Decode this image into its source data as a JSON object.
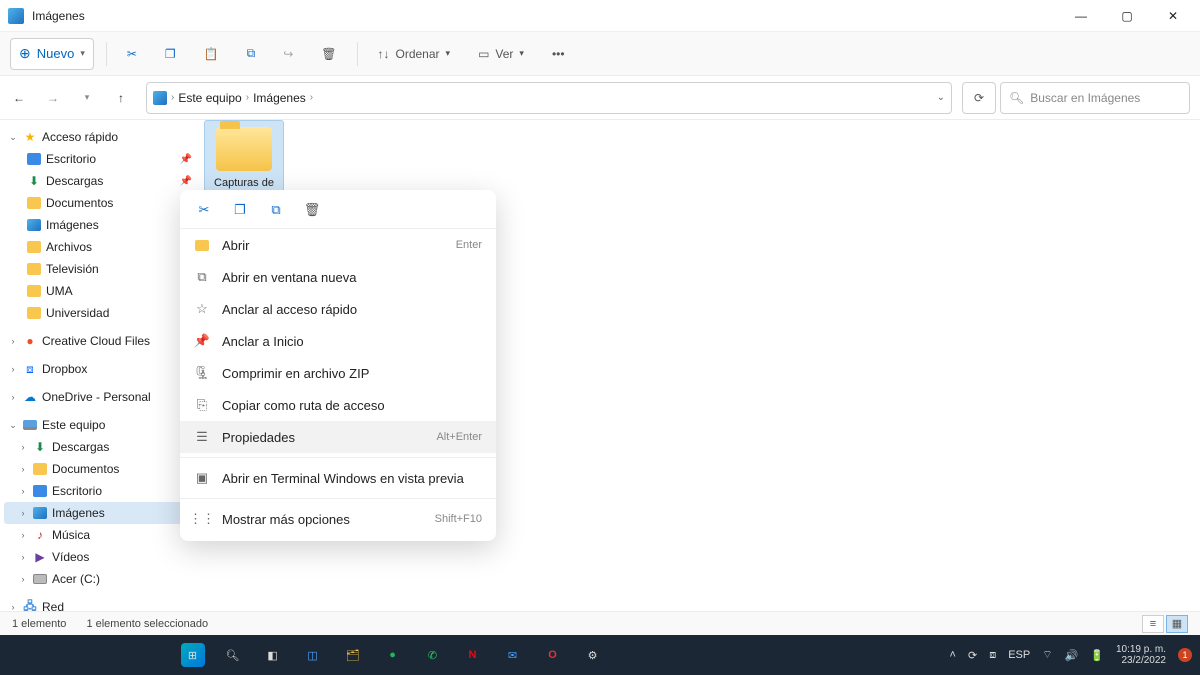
{
  "window": {
    "title": "Imágenes"
  },
  "toolbar": {
    "new_label": "Nuevo",
    "sort_label": "Ordenar",
    "view_label": "Ver"
  },
  "breadcrumb": {
    "root": "Este equipo",
    "current": "Imágenes"
  },
  "search": {
    "placeholder": "Buscar en Imágenes"
  },
  "sidebar": {
    "quick_access": "Acceso rápido",
    "quick_items": [
      {
        "label": "Escritorio",
        "pin": true,
        "ic": "blue"
      },
      {
        "label": "Descargas",
        "pin": true,
        "ic": "dl"
      },
      {
        "label": "Documentos",
        "pin": true,
        "ic": "folder"
      },
      {
        "label": "Imágenes",
        "pin": true,
        "ic": "img"
      },
      {
        "label": "Archivos",
        "pin": false,
        "ic": "folder"
      },
      {
        "label": "Televisión",
        "pin": false,
        "ic": "folder"
      },
      {
        "label": "UMA",
        "pin": false,
        "ic": "folder"
      },
      {
        "label": "Universidad",
        "pin": false,
        "ic": "folder"
      }
    ],
    "creative_cloud": "Creative Cloud Files",
    "dropbox": "Dropbox",
    "onedrive": "OneDrive - Personal",
    "this_pc": "Este equipo",
    "pc_items": [
      {
        "label": "Descargas",
        "ic": "dl"
      },
      {
        "label": "Documentos",
        "ic": "folder"
      },
      {
        "label": "Escritorio",
        "ic": "blue"
      },
      {
        "label": "Imágenes",
        "ic": "img",
        "selected": true
      },
      {
        "label": "Música",
        "ic": "music"
      },
      {
        "label": "Vídeos",
        "ic": "video"
      },
      {
        "label": "Acer (C:)",
        "ic": "disk"
      }
    ],
    "network": "Red"
  },
  "content": {
    "folder_label": "Capturas de pantalla"
  },
  "context_menu": {
    "items": [
      {
        "label": "Abrir",
        "shortcut": "Enter",
        "ic": "folder"
      },
      {
        "label": "Abrir en ventana nueva",
        "ic": "newwin"
      },
      {
        "label": "Anclar al acceso rápido",
        "ic": "star"
      },
      {
        "label": "Anclar a Inicio",
        "ic": "pin"
      },
      {
        "label": "Comprimir en archivo ZIP",
        "ic": "zip"
      },
      {
        "label": "Copiar como ruta de acceso",
        "ic": "path"
      },
      {
        "label": "Propiedades",
        "shortcut": "Alt+Enter",
        "ic": "props",
        "hover": true
      },
      {
        "sep": true
      },
      {
        "label": "Abrir en Terminal Windows en vista previa",
        "ic": "term"
      },
      {
        "sep": true
      },
      {
        "label": "Mostrar más opciones",
        "shortcut": "Shift+F10",
        "ic": "more"
      }
    ]
  },
  "status": {
    "count": "1 elemento",
    "selected": "1 elemento seleccionado"
  },
  "taskbar": {
    "lang": "ESP",
    "time": "10:19 p. m.",
    "date": "23/2/2022",
    "notif": "1"
  }
}
